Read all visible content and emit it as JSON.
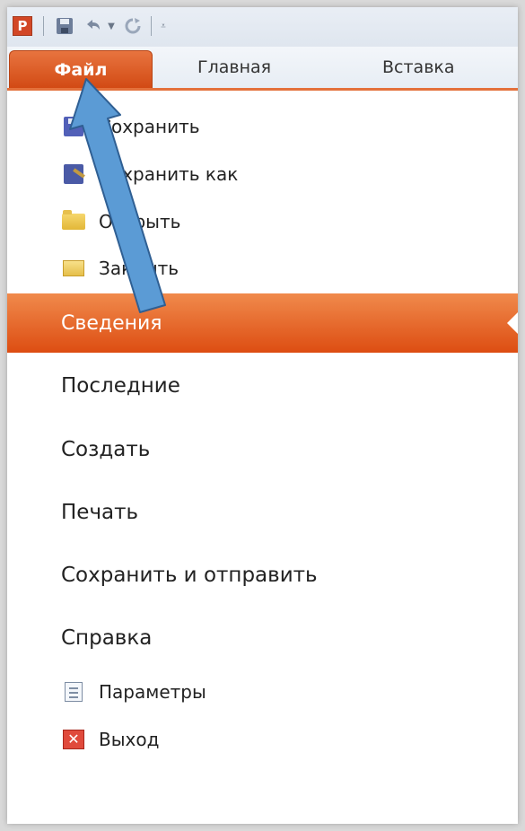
{
  "qat": {
    "app_icon": "P",
    "icons": [
      "powerpoint-app-icon",
      "save-icon",
      "undo-icon",
      "redo-icon",
      "customize-qat-icon"
    ]
  },
  "tabs": {
    "file": "Файл",
    "home": "Главная",
    "insert": "Вставка"
  },
  "menu": {
    "save": "Сохранить",
    "save_as": "Сохранить как",
    "open": "Открыть",
    "close": "Закрыть",
    "info": "Сведения",
    "recent": "Последние",
    "new": "Создать",
    "print": "Печать",
    "save_send": "Сохранить и отправить",
    "help": "Справка",
    "options": "Параметры",
    "exit": "Выход"
  },
  "colors": {
    "accent": "#d24a14",
    "selected": "#dd4d12",
    "arrow": "#5b9bd5"
  }
}
